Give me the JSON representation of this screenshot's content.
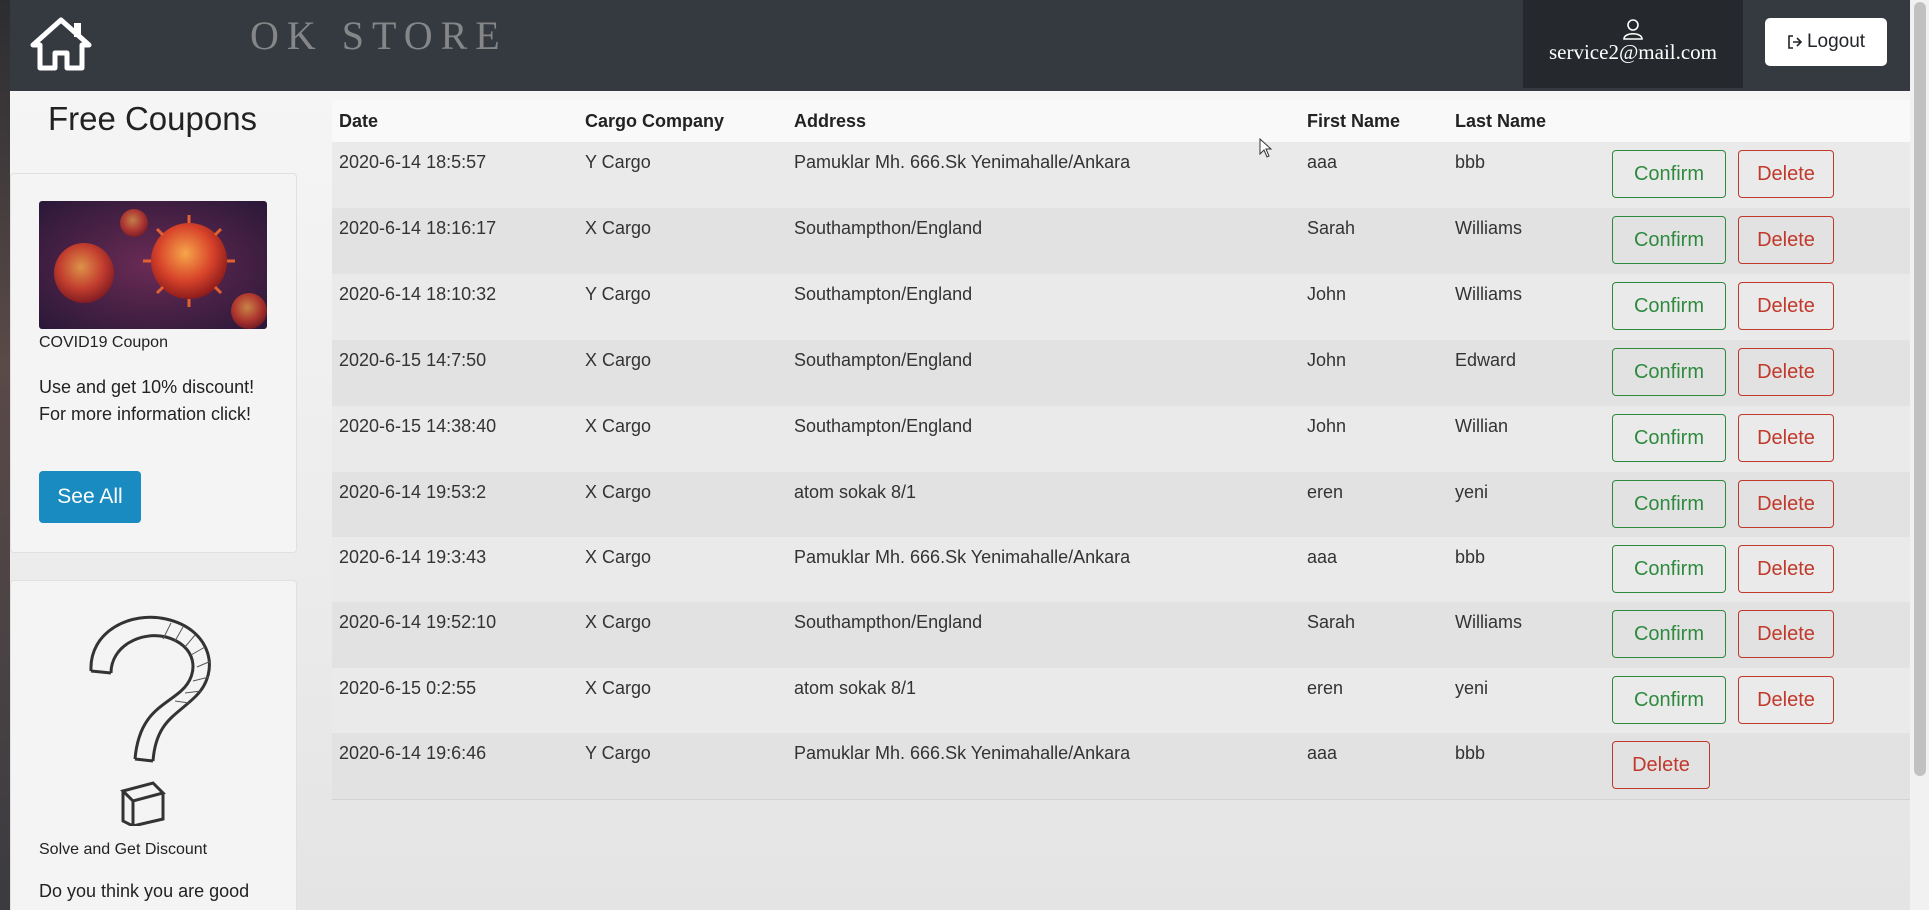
{
  "header": {
    "brand": "OK STORE",
    "user_email": "service2@mail.com",
    "logout_label": "Logout"
  },
  "sidebar": {
    "coupons_title": "Free Coupons",
    "coupon": {
      "label": "COVID19 Coupon",
      "text": "Use and get 10% discount! For more information click!",
      "button": "See All"
    },
    "quiz": {
      "label": "Solve and Get Discount",
      "text": "Do you think you are good"
    }
  },
  "table": {
    "columns": [
      "Date",
      "Cargo Company",
      "Address",
      "First Name",
      "Last Name"
    ],
    "confirm_label": "Confirm",
    "delete_label": "Delete",
    "rows": [
      {
        "date": "2020-6-14 18:5:57",
        "cargo": "Y Cargo",
        "address": "Pamuklar Mh. 666.Sk Yenimahalle/Ankara",
        "first": "aaa",
        "last": "bbb",
        "confirmable": true
      },
      {
        "date": "2020-6-14 18:16:17",
        "cargo": "X Cargo",
        "address": "Southampthon/England",
        "first": "Sarah",
        "last": "Williams",
        "confirmable": true
      },
      {
        "date": "2020-6-14 18:10:32",
        "cargo": "Y Cargo",
        "address": "Southampton/England",
        "first": "John",
        "last": "Williams",
        "confirmable": true
      },
      {
        "date": "2020-6-15 14:7:50",
        "cargo": "X Cargo",
        "address": "Southampton/England",
        "first": "John",
        "last": "Edward",
        "confirmable": true
      },
      {
        "date": "2020-6-15 14:38:40",
        "cargo": "X Cargo",
        "address": "Southampton/England",
        "first": "John",
        "last": "Willian",
        "confirmable": true
      },
      {
        "date": "2020-6-14 19:53:2",
        "cargo": "X Cargo",
        "address": "atom sokak 8/1",
        "first": "eren",
        "last": "yeni",
        "confirmable": true
      },
      {
        "date": "2020-6-14 19:3:43",
        "cargo": "X Cargo",
        "address": "Pamuklar Mh. 666.Sk Yenimahalle/Ankara",
        "first": "aaa",
        "last": "bbb",
        "confirmable": true
      },
      {
        "date": "2020-6-14 19:52:10",
        "cargo": "X Cargo",
        "address": "Southampthon/England",
        "first": "Sarah",
        "last": "Williams",
        "confirmable": true
      },
      {
        "date": "2020-6-15 0:2:55",
        "cargo": "X Cargo",
        "address": "atom sokak 8/1",
        "first": "eren",
        "last": "yeni",
        "confirmable": true
      },
      {
        "date": "2020-6-14 19:6:46",
        "cargo": "Y Cargo",
        "address": "Pamuklar Mh. 666.Sk Yenimahalle/Ankara",
        "first": "aaa",
        "last": "bbb",
        "confirmable": false
      }
    ]
  },
  "colors": {
    "header_bg": "#343a40",
    "confirm": "#2f8a3f",
    "delete": "#c0392b",
    "see_all": "#1a8bc0"
  }
}
